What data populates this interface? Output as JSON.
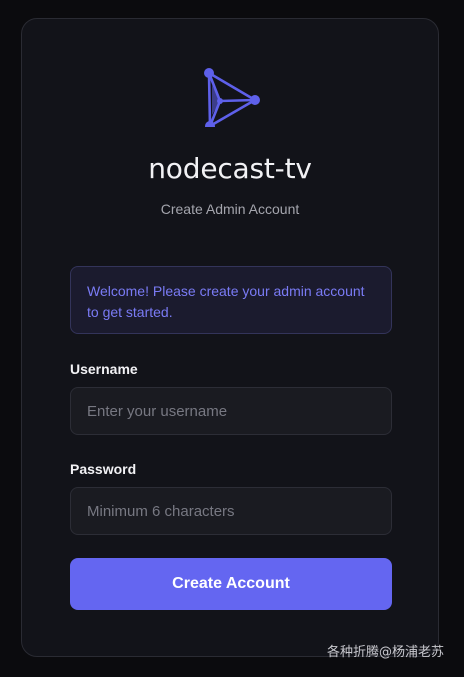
{
  "app": {
    "title": "nodecast-tv",
    "subtitle": "Create Admin Account",
    "logo_icon": "play-triangle-node-logo-icon",
    "accent_color": "#6466f1"
  },
  "notice": {
    "text": "Welcome! Please create your admin account to get started."
  },
  "form": {
    "username": {
      "label": "Username",
      "placeholder": "Enter your username",
      "value": ""
    },
    "password": {
      "label": "Password",
      "placeholder": "Minimum 6 characters",
      "value": ""
    },
    "submit_label": "Create Account"
  },
  "watermark": {
    "text": "各种折腾@杨浦老苏"
  }
}
